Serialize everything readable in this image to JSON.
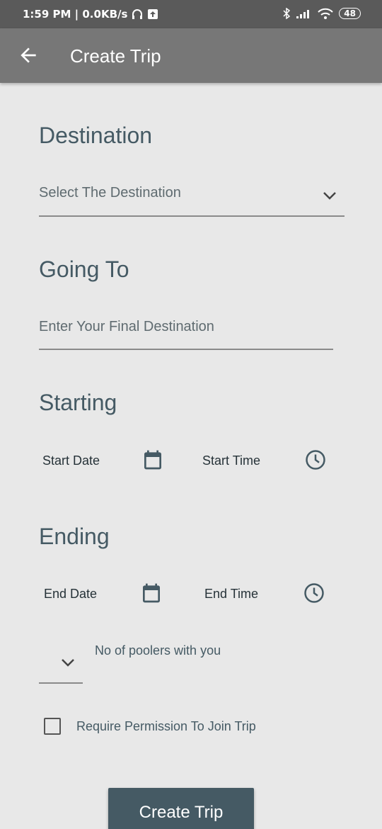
{
  "status_bar": {
    "time_and_speed": "1:59 PM | 0.0KB/s",
    "battery": "48"
  },
  "app_bar": {
    "title": "Create Trip"
  },
  "destination": {
    "title": "Destination",
    "select_placeholder": "Select The Destination"
  },
  "going_to": {
    "title": "Going To",
    "input_placeholder": "Enter Your Final Destination"
  },
  "starting": {
    "title": "Starting",
    "date_label": "Start Date",
    "time_label": "Start Time"
  },
  "ending": {
    "title": "Ending",
    "date_label": "End Date",
    "time_label": "End Time"
  },
  "poolers": {
    "label": "No of poolers with you"
  },
  "permission": {
    "label": "Require Permission To Join Trip"
  },
  "submit": {
    "label": "Create Trip"
  },
  "colors": {
    "accent": "#455a64",
    "app_bar": "#777777",
    "background": "#e8e8e8"
  }
}
